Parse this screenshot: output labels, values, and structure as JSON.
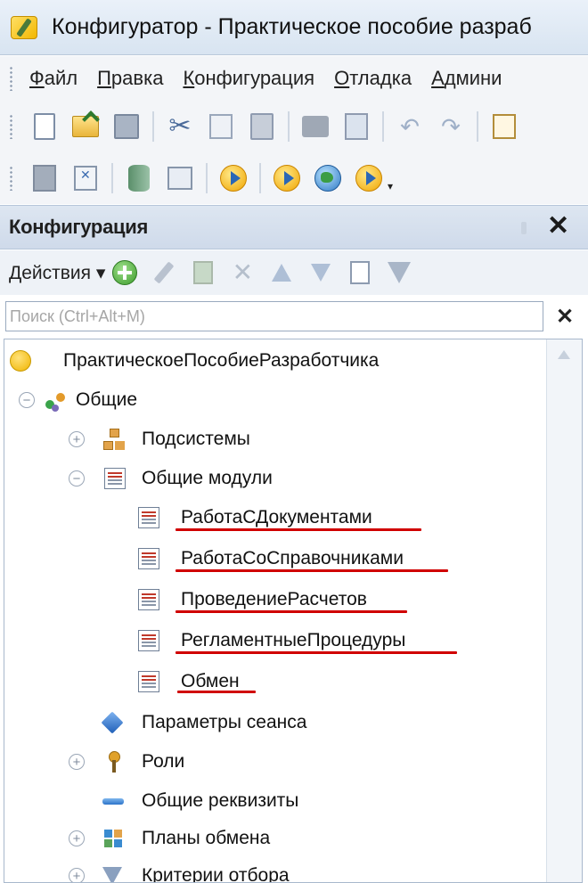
{
  "window": {
    "title": "Конфигуратор - Практическое пособие разраб"
  },
  "menu": [
    "Файл",
    "Правка",
    "Конфигурация",
    "Отладка",
    "Админи"
  ],
  "toolbar1": [
    "new-doc-icon",
    "open-icon",
    "save-icon",
    "cut-icon",
    "copy-icon",
    "paste-icon",
    "print-icon",
    "preview-icon",
    "undo-icon",
    "redo-icon",
    "find-icon"
  ],
  "toolbar2": [
    "module-icon",
    "edit-form-icon",
    "database-icon",
    "window-icon",
    "run-icon",
    "debug-icon",
    "web-client-icon",
    "thin-client-icon"
  ],
  "panel": {
    "title": "Конфигурация",
    "actions_label": "Действия ▾",
    "search_placeholder": "Поиск (Ctrl+Alt+M)"
  },
  "tree": {
    "root": "ПрактическоеПособиеРазработчика",
    "general": "Общие",
    "subsystems": "Подсистемы",
    "common_modules": "Общие модули",
    "modules": [
      "РаботаСДокументами",
      "РаботаСоСправочниками",
      "ПроведениеРасчетов",
      "РегламентныеПроцедуры",
      "Обмен"
    ],
    "session_params": "Параметры сеанса",
    "roles": "Роли",
    "common_attrs": "Общие реквизиты",
    "exchange_plans": "Планы обмена",
    "filter_criteria": "Критерии отбора"
  },
  "highlight_color": "#d00000"
}
